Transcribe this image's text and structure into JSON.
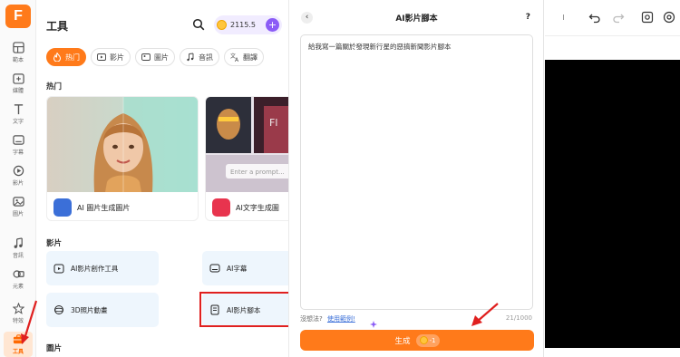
{
  "rail": {
    "logo": "F",
    "items": [
      {
        "label": "範本",
        "icon": "template-icon"
      },
      {
        "label": "媒體",
        "icon": "media-icon"
      },
      {
        "label": "文字",
        "icon": "text-icon"
      },
      {
        "label": "字幕",
        "icon": "subtitle-icon"
      },
      {
        "label": "影片",
        "icon": "video-icon"
      },
      {
        "label": "圖片",
        "icon": "image-icon"
      },
      {
        "label": "音訊",
        "icon": "audio-icon"
      },
      {
        "label": "元素",
        "icon": "element-icon"
      },
      {
        "label": "特效",
        "icon": "effects-icon"
      },
      {
        "label": "工具",
        "icon": "toolbox-icon"
      }
    ]
  },
  "tools": {
    "title": "工具",
    "credits": "2115.5",
    "tabs": [
      "热门",
      "影片",
      "圖片",
      "音訊",
      "翻譯"
    ],
    "hot_label": "热门",
    "cards": [
      {
        "label": "AI 圖片生成圖片"
      },
      {
        "label": "AI文字生成圖",
        "prompt": "Enter a prompt..."
      }
    ],
    "video_label": "影片",
    "video_tools": [
      "AI影片創作工具",
      "AI字幕",
      "3D照片動畫",
      "AI影片腳本"
    ],
    "image_label": "圖片"
  },
  "panel": {
    "back": "‹",
    "title": "AI影片腳本",
    "help": "?",
    "prompt_text": "給我寫一篇關於發現新行星的惡搞新聞影片腳本",
    "hint": "沒想法?",
    "example_link": "使用範例!",
    "counter": "21/1000",
    "generate_label": "生成",
    "cost": "-1"
  },
  "colors": {
    "accent": "#ff7a1a",
    "highlight": "#e0201f",
    "tile_bg": "#eef6fd"
  }
}
